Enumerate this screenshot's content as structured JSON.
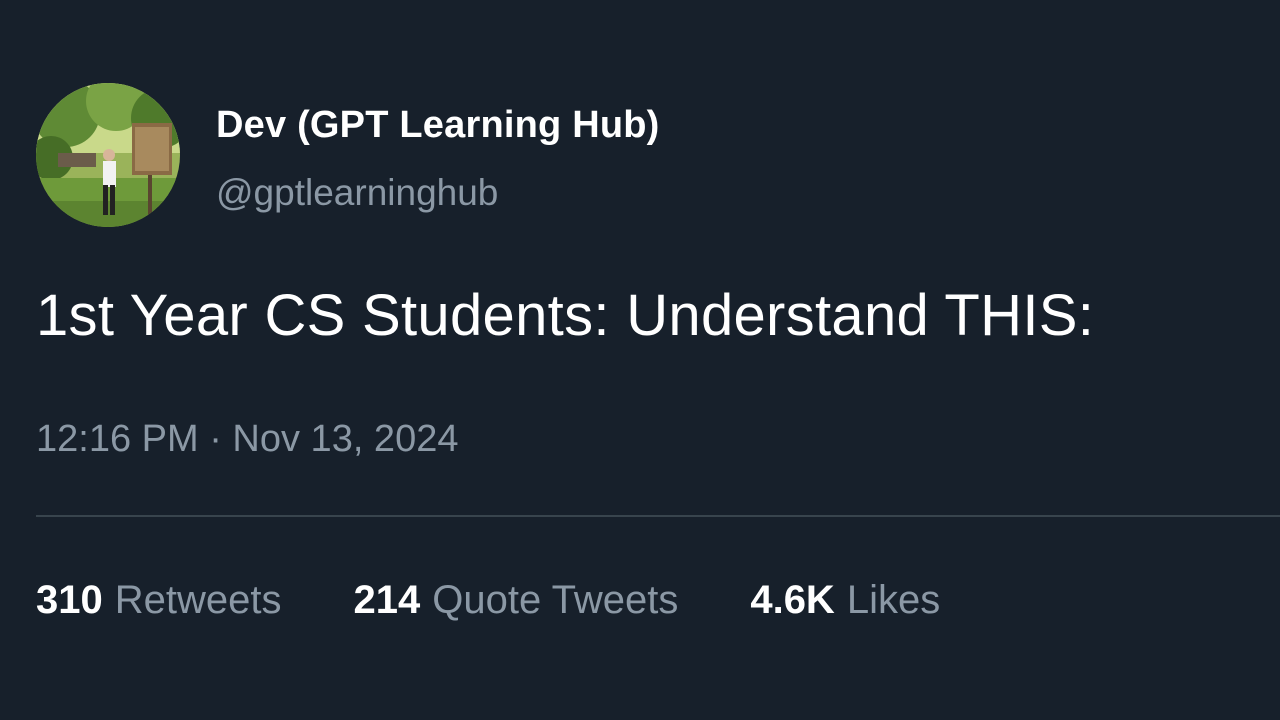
{
  "author": {
    "display_name": "Dev (GPT Learning Hub)",
    "handle": "@gptlearninghub",
    "avatar": "profile-photo"
  },
  "tweet": {
    "text": "1st Year CS Students: Understand THIS:",
    "timestamp": "12:16 PM · Nov 13, 2024"
  },
  "stats": {
    "retweets": {
      "count": "310",
      "label": "Retweets"
    },
    "quote_tweets": {
      "count": "214",
      "label": "Quote Tweets"
    },
    "likes": {
      "count": "4.6K",
      "label": "Likes"
    }
  },
  "colors": {
    "background": "#17202b",
    "primary_text": "#ffffff",
    "secondary_text": "#8b98a5",
    "divider": "#38444d"
  }
}
